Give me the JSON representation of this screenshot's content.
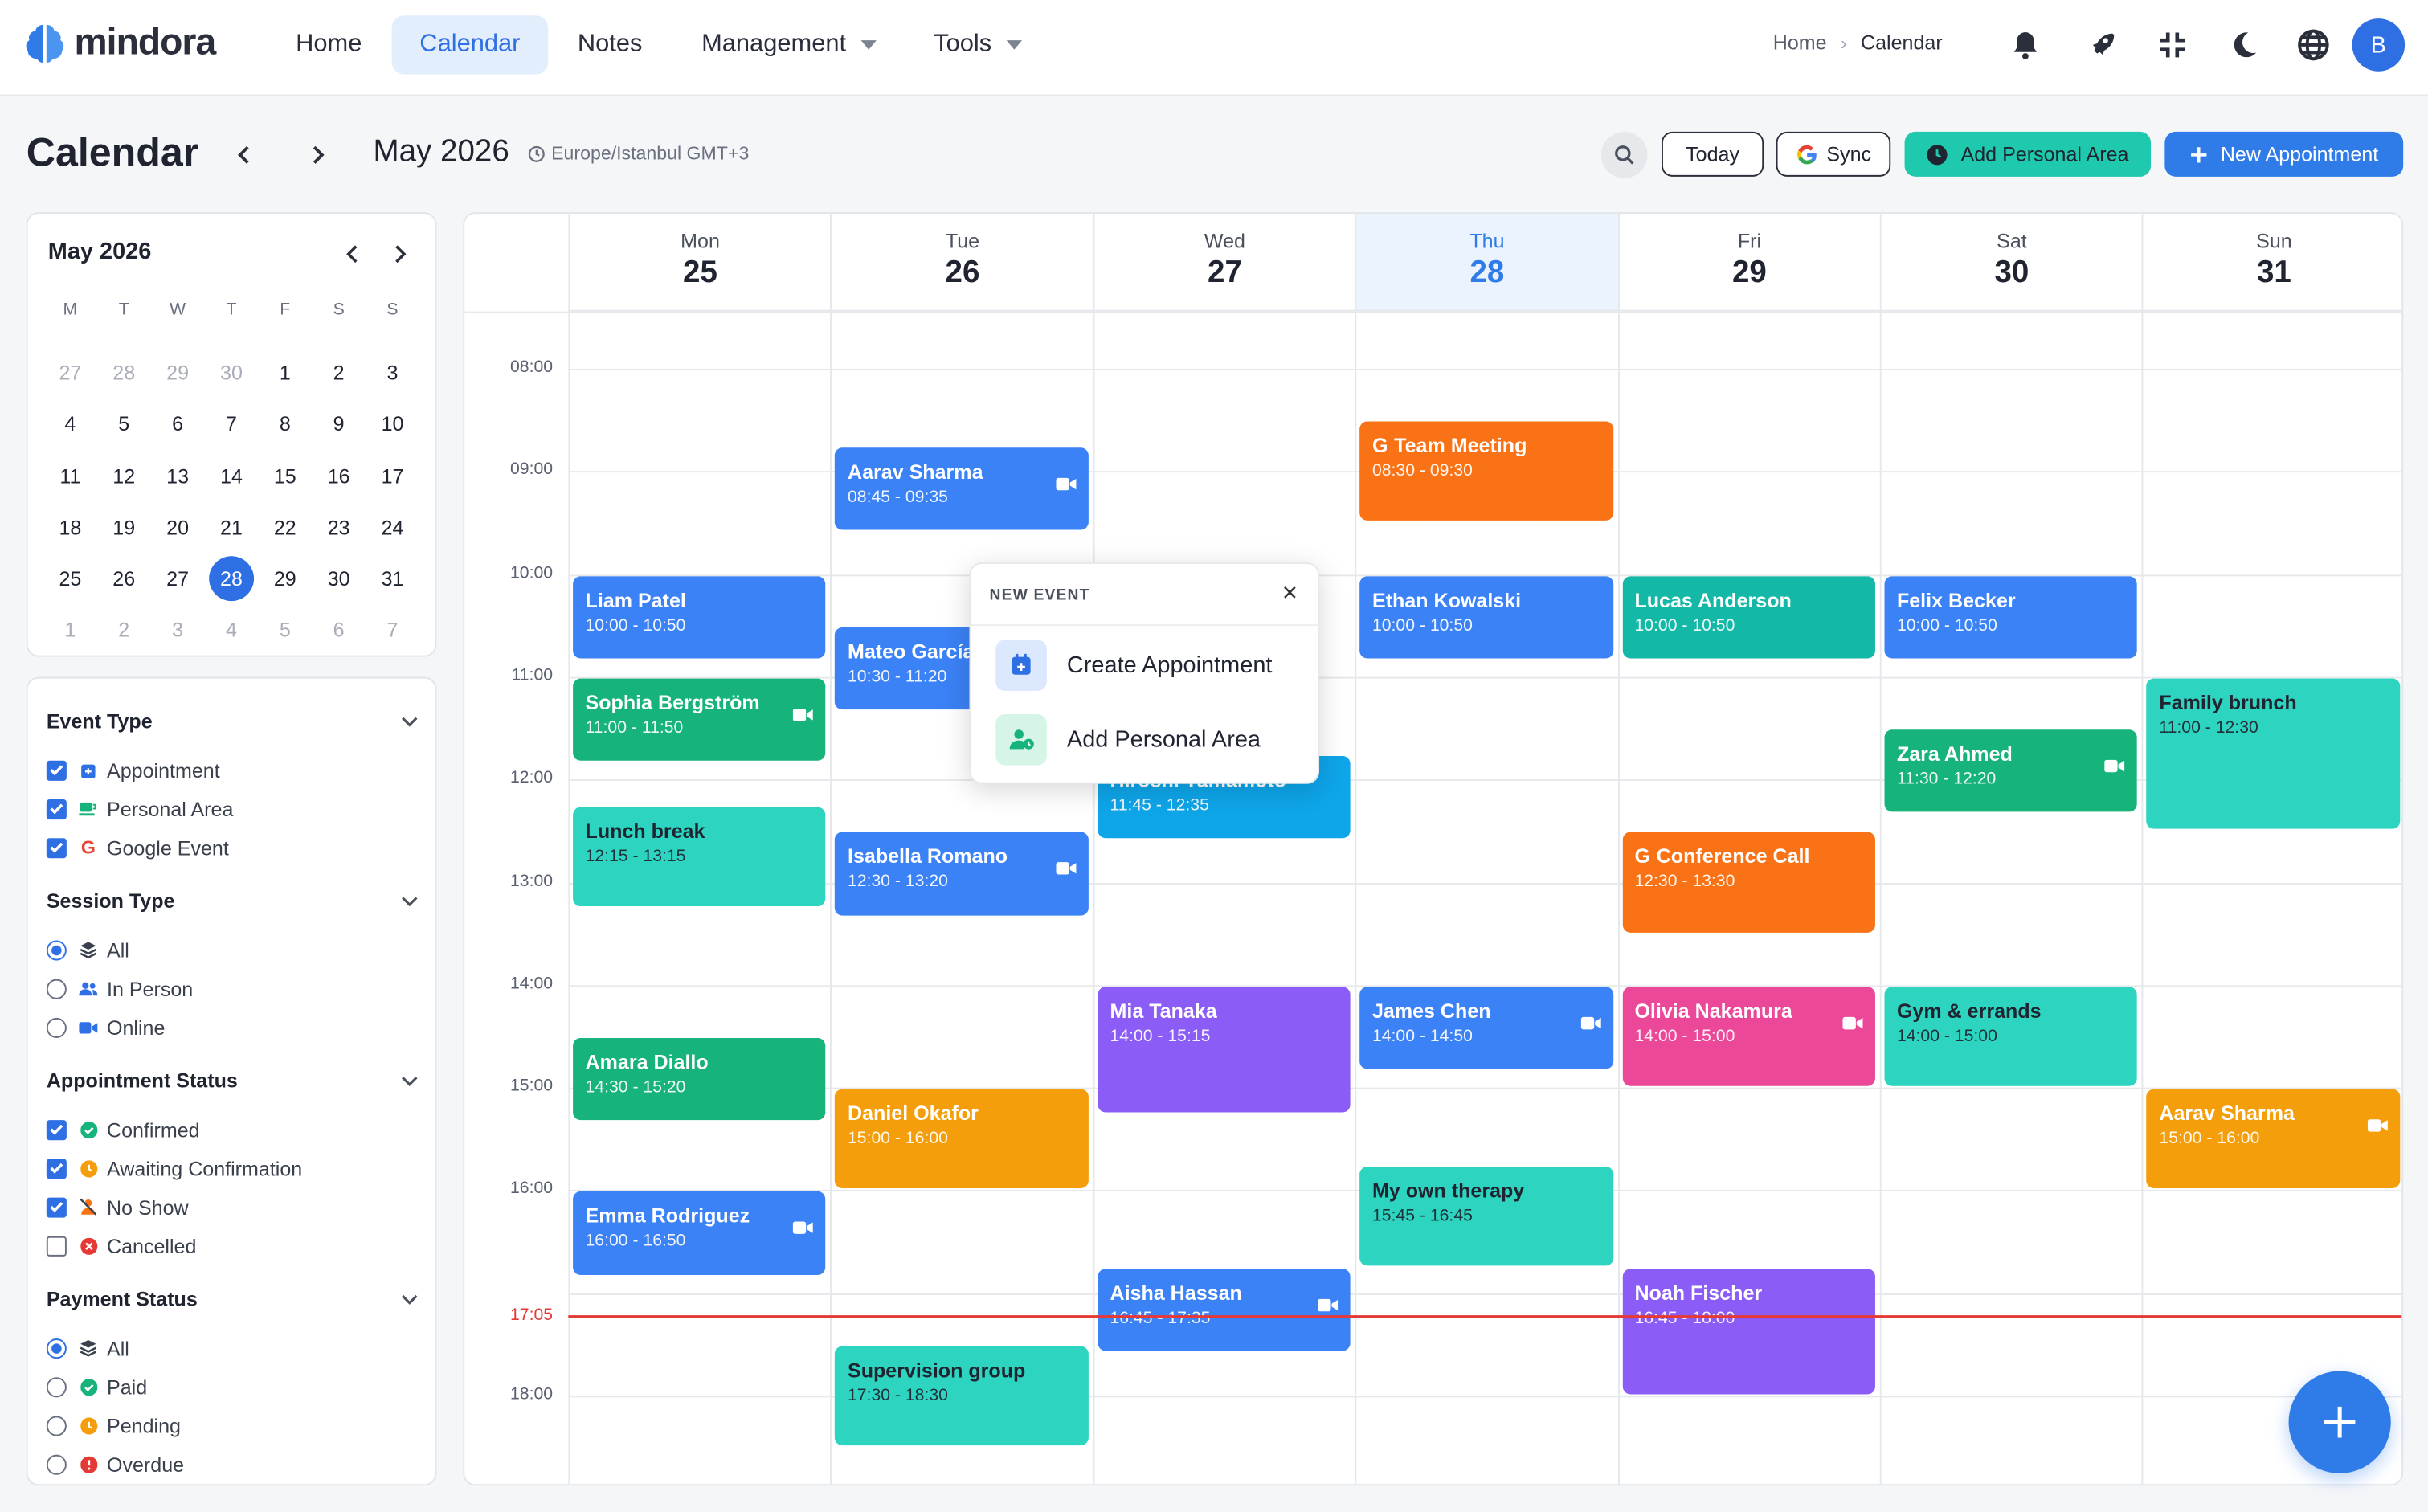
{
  "app": {
    "name": "mindora"
  },
  "nav": {
    "home": "Home",
    "calendar": "Calendar",
    "notes": "Notes",
    "management": "Management",
    "tools": "Tools"
  },
  "breadcrumb": {
    "home": "Home",
    "current": "Calendar"
  },
  "user": {
    "initial": "B"
  },
  "toolbar": {
    "title": "Calendar",
    "month": "May 2026",
    "timezone": "Europe/Istanbul GMT+3",
    "today_label": "Today",
    "sync_label": "Sync",
    "add_personal_label": "Add Personal Area",
    "new_appointment_label": "New Appointment"
  },
  "mini_calendar": {
    "title": "May 2026",
    "weekdays": [
      "M",
      "T",
      "W",
      "T",
      "F",
      "S",
      "S"
    ],
    "weeks": [
      [
        {
          "d": "27",
          "m": true
        },
        {
          "d": "28",
          "m": true
        },
        {
          "d": "29",
          "m": true
        },
        {
          "d": "30",
          "m": true
        },
        {
          "d": "1"
        },
        {
          "d": "2"
        },
        {
          "d": "3"
        }
      ],
      [
        {
          "d": "4"
        },
        {
          "d": "5"
        },
        {
          "d": "6"
        },
        {
          "d": "7"
        },
        {
          "d": "8"
        },
        {
          "d": "9"
        },
        {
          "d": "10"
        }
      ],
      [
        {
          "d": "11"
        },
        {
          "d": "12"
        },
        {
          "d": "13"
        },
        {
          "d": "14"
        },
        {
          "d": "15"
        },
        {
          "d": "16"
        },
        {
          "d": "17"
        }
      ],
      [
        {
          "d": "18"
        },
        {
          "d": "19"
        },
        {
          "d": "20"
        },
        {
          "d": "21"
        },
        {
          "d": "22"
        },
        {
          "d": "23"
        },
        {
          "d": "24"
        }
      ],
      [
        {
          "d": "25"
        },
        {
          "d": "26"
        },
        {
          "d": "27"
        },
        {
          "d": "28",
          "t": true
        },
        {
          "d": "29"
        },
        {
          "d": "30"
        },
        {
          "d": "31"
        }
      ],
      [
        {
          "d": "1",
          "m": true
        },
        {
          "d": "2",
          "m": true
        },
        {
          "d": "3",
          "m": true
        },
        {
          "d": "4",
          "m": true
        },
        {
          "d": "5",
          "m": true
        },
        {
          "d": "6",
          "m": true
        },
        {
          "d": "7",
          "m": true
        }
      ]
    ]
  },
  "filters": {
    "event_type": {
      "title": "Event Type",
      "options": [
        "Appointment",
        "Personal Area",
        "Google Event"
      ]
    },
    "session_type": {
      "title": "Session Type",
      "options": [
        "All",
        "In Person",
        "Online"
      ]
    },
    "appointment_status": {
      "title": "Appointment Status",
      "options": [
        "Confirmed",
        "Awaiting Confirmation",
        "No Show",
        "Cancelled"
      ]
    },
    "payment_status": {
      "title": "Payment Status",
      "options": [
        "All",
        "Paid",
        "Pending",
        "Overdue"
      ]
    }
  },
  "week": [
    {
      "name": "Mon",
      "num": "25"
    },
    {
      "name": "Tue",
      "num": "26"
    },
    {
      "name": "Wed",
      "num": "27"
    },
    {
      "name": "Thu",
      "num": "28",
      "today": true
    },
    {
      "name": "Fri",
      "num": "29"
    },
    {
      "name": "Sat",
      "num": "30"
    },
    {
      "name": "Sun",
      "num": "31"
    }
  ],
  "hours": [
    "08:00",
    "09:00",
    "10:00",
    "11:00",
    "12:00",
    "13:00",
    "14:00",
    "15:00",
    "16:00",
    "18:00"
  ],
  "now_label": "17:05",
  "colors": {
    "blue": "#3b82f6",
    "green": "#16b37a",
    "teal": "#2dd4bf",
    "orange": "#f97316",
    "amber": "#f59e0b",
    "purple": "#8b5cf6",
    "pink": "#ec4899",
    "sky": "#0ea5e9",
    "tealdark": "#14b8a6"
  },
  "events": [
    {
      "day": 0,
      "start": "10:00",
      "end": "10:50",
      "title": "Liam Patel",
      "time": "10:00 - 10:50",
      "color": "blue"
    },
    {
      "day": 0,
      "start": "11:00",
      "end": "11:50",
      "title": "Sophia Bergström",
      "time": "11:00 - 11:50",
      "color": "green",
      "video": true
    },
    {
      "day": 0,
      "start": "12:15",
      "end": "13:15",
      "title": "Lunch break",
      "time": "12:15 - 13:15",
      "color": "teal",
      "dark": true
    },
    {
      "day": 0,
      "start": "14:30",
      "end": "15:20",
      "title": "Amara Diallo",
      "time": "14:30 - 15:20",
      "color": "green"
    },
    {
      "day": 0,
      "start": "16:00",
      "end": "16:50",
      "title": "Emma Rodriguez",
      "time": "16:00 - 16:50",
      "color": "blue",
      "video": true
    },
    {
      "day": 1,
      "start": "08:45",
      "end": "09:35",
      "title": "Aarav Sharma",
      "time": "08:45 - 09:35",
      "color": "blue",
      "video": true
    },
    {
      "day": 1,
      "start": "10:30",
      "end": "11:20",
      "title": "Mateo García",
      "time": "10:30 - 11:20",
      "color": "blue"
    },
    {
      "day": 1,
      "start": "12:30",
      "end": "13:20",
      "title": "Isabella Romano",
      "time": "12:30 - 13:20",
      "color": "blue",
      "video": true
    },
    {
      "day": 1,
      "start": "15:00",
      "end": "16:00",
      "title": "Daniel Okafor",
      "time": "15:00 - 16:00",
      "color": "amber"
    },
    {
      "day": 1,
      "start": "17:30",
      "end": "18:30",
      "title": "Supervision group",
      "time": "17:30 - 18:30",
      "color": "teal",
      "dark": true
    },
    {
      "day": 2,
      "start": "11:45",
      "end": "12:35",
      "title": "Hiroshi Yamamoto",
      "time": "11:45 - 12:35",
      "color": "sky"
    },
    {
      "day": 2,
      "start": "14:00",
      "end": "15:15",
      "title": "Mia Tanaka",
      "time": "14:00 - 15:15",
      "color": "purple"
    },
    {
      "day": 2,
      "start": "16:45",
      "end": "17:35",
      "title": "Aisha Hassan",
      "time": "16:45 - 17:35",
      "color": "blue",
      "video": true
    },
    {
      "day": 3,
      "start": "08:30",
      "end": "09:30",
      "title": "Team Meeting",
      "time": "08:30 - 09:30",
      "color": "orange",
      "google": true
    },
    {
      "day": 3,
      "start": "10:00",
      "end": "10:50",
      "title": "Ethan Kowalski",
      "time": "10:00 - 10:50",
      "color": "blue"
    },
    {
      "day": 3,
      "start": "14:00",
      "end": "14:50",
      "title": "James Chen",
      "time": "14:00 - 14:50",
      "color": "blue",
      "video": true
    },
    {
      "day": 3,
      "start": "15:45",
      "end": "16:45",
      "title": "My own therapy",
      "time": "15:45 - 16:45",
      "color": "teal",
      "dark": true
    },
    {
      "day": 4,
      "start": "10:00",
      "end": "10:50",
      "title": "Lucas Anderson",
      "time": "10:00 - 10:50",
      "color": "tealdark"
    },
    {
      "day": 4,
      "start": "12:30",
      "end": "13:30",
      "title": "Conference Call",
      "time": "12:30 - 13:30",
      "color": "orange",
      "google": true
    },
    {
      "day": 4,
      "start": "14:00",
      "end": "15:00",
      "title": "Olivia Nakamura",
      "time": "14:00 - 15:00",
      "color": "pink",
      "video": true
    },
    {
      "day": 4,
      "start": "16:45",
      "end": "18:00",
      "title": "Noah Fischer",
      "time": "16:45 - 18:00",
      "color": "purple"
    },
    {
      "day": 5,
      "start": "10:00",
      "end": "10:50",
      "title": "Felix Becker",
      "time": "10:00 - 10:50",
      "color": "blue"
    },
    {
      "day": 5,
      "start": "11:30",
      "end": "12:20",
      "title": "Zara Ahmed",
      "time": "11:30 - 12:20",
      "color": "green",
      "video": true
    },
    {
      "day": 5,
      "start": "14:00",
      "end": "15:00",
      "title": "Gym & errands",
      "time": "14:00 - 15:00",
      "color": "teal",
      "dark": true
    },
    {
      "day": 6,
      "start": "11:00",
      "end": "12:30",
      "title": "Family brunch",
      "time": "11:00 - 12:30",
      "color": "teal",
      "dark": true
    },
    {
      "day": 6,
      "start": "15:00",
      "end": "16:00",
      "title": "Aarav Sharma",
      "time": "15:00 - 16:00",
      "color": "amber",
      "video": true
    }
  ],
  "popup": {
    "title": "NEW EVENT",
    "create_label": "Create Appointment",
    "personal_label": "Add Personal Area"
  }
}
